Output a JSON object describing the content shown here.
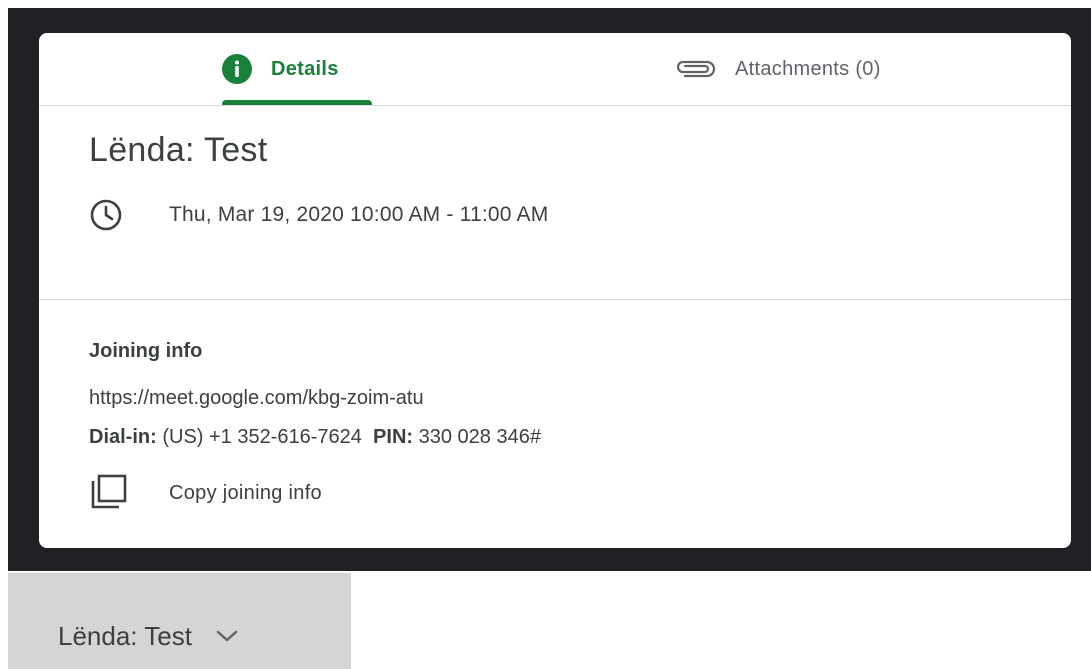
{
  "tabs": [
    {
      "label": "Details",
      "icon": "info-icon",
      "active": true
    },
    {
      "label": "Attachments (0)",
      "icon": "paperclip-icon",
      "active": false
    }
  ],
  "event": {
    "title": "Lënda: Test",
    "datetime": "Thu, Mar 19, 2020 10:00 AM - 11:00 AM"
  },
  "joining": {
    "heading": "Joining info",
    "link": "https://meet.google.com/kbg-zoim-atu",
    "dialin_label": "Dial-in:",
    "dialin_value": "(US) +1 352-616-7624",
    "pin_label": "PIN:",
    "pin_value": "330 028 346#",
    "copy_label": "Copy joining info"
  },
  "bottom_chip": {
    "label": "Lënda: Test",
    "icon": "chevron-down-icon"
  },
  "colors": {
    "accent": "#188038",
    "backdrop": "#202124",
    "text": "#3c4043",
    "chip_bg": "#d5d5d5"
  }
}
